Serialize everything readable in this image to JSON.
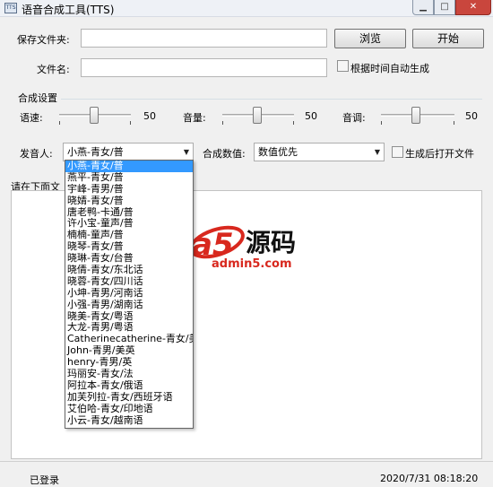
{
  "window": {
    "title": "语音合成工具(TTS)",
    "icon_text": "TTS",
    "minimize": "▁",
    "maximize": "□",
    "close": "✕"
  },
  "form": {
    "save_folder_label": "保存文件夹:",
    "save_folder_value": "",
    "browse_button": "浏览",
    "start_button": "开始",
    "filename_label": "文件名:",
    "filename_value": "",
    "auto_generate_label": "根据时间自动生成",
    "auto_generate_checked": false
  },
  "synthesis": {
    "group_title": "合成设置",
    "speed": {
      "label": "语速:",
      "value": "50"
    },
    "volume": {
      "label": "音量:",
      "value": "50"
    },
    "pitch": {
      "label": "音调:",
      "value": "50"
    },
    "speaker_label": "发音人:",
    "speaker_selected": "小燕-青女/普",
    "value_label": "合成数值:",
    "value_selected": "数值优先",
    "open_after_label": "生成后打开文件",
    "open_after_checked": false
  },
  "input_area": {
    "label": "请在下面文"
  },
  "speakers": [
    "小燕-青女/普",
    "燕平-青女/普",
    "宇峰-青男/普",
    "晓婧-青女/普",
    "唐老鸭-卡通/普",
    "许小宝-童声/普",
    "楠楠-童声/普",
    "晓琴-青女/普",
    "晓琳-青女/台普",
    "晓倩-青女/东北话",
    "晓蓉-青女/四川话",
    "小坤-青男/河南话",
    "小强-青男/湖南话",
    "晓美-青女/粤语",
    "大龙-青男/粤语",
    "Catherinecatherine-青女/美英",
    "John-青男/美英",
    "henry-青男/英",
    "玛丽安-青女/法",
    "阿拉本-青女/俄语",
    "加芙列拉-青女/西班牙语",
    "艾伯哈-青女/印地语",
    "小云-青女/越南语"
  ],
  "watermark": {
    "brand": "a5",
    "chinese": "源码",
    "url": "admin5.com",
    "color_red": "#d8281e"
  },
  "status": {
    "left": "已登录",
    "right": "2020/7/31 08:18:20"
  }
}
